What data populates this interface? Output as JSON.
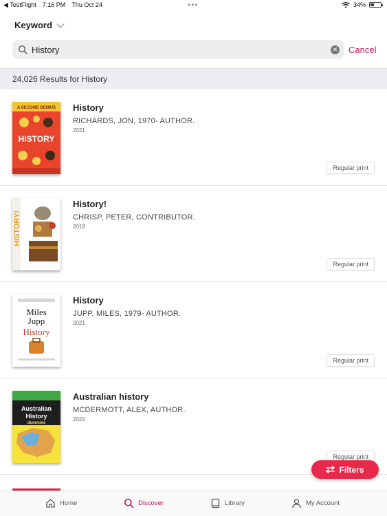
{
  "status_bar": {
    "back_app": "◀ TestFlight",
    "time": "7:16 PM",
    "date": "Thu Oct 24",
    "dots": "•••",
    "battery_percent": "34%",
    "battery_level": 0.34
  },
  "search_type": {
    "label": "Keyword"
  },
  "search": {
    "value": "History",
    "cancel_label": "Cancel"
  },
  "results": {
    "summary": "24,026 Results for History"
  },
  "items": [
    {
      "title": "History",
      "author": "RICHARDS, JON, 1970- AUTHOR.",
      "year": "2021",
      "format": "Regular print"
    },
    {
      "title": "History!",
      "author": "CHRISP, PETER, CONTRIBUTOR.",
      "year": "2019",
      "format": "Regular print"
    },
    {
      "title": "History",
      "author": "JUPP, MILES, 1979- AUTHOR.",
      "year": "2021",
      "format": "Regular print"
    },
    {
      "title": "Australian history",
      "author": "MCDERMOTT, ALEX, AUTHOR.",
      "year": "2022",
      "format": "Regular print"
    }
  ],
  "covers": {
    "c1": {
      "banner": "A SECOND GENIUS",
      "title": "HISTORY"
    },
    "c2": {
      "title": "HISTORY!"
    },
    "c3": {
      "line1": "Miles",
      "line2": "Jupp",
      "line3": "History"
    },
    "c4": {
      "line1": "Australian",
      "line2": "History",
      "line3": "dummies"
    }
  },
  "filters_label": "Filters",
  "tabs": [
    {
      "label": "Home"
    },
    {
      "label": "Discover"
    },
    {
      "label": "Library"
    },
    {
      "label": "My Account"
    }
  ],
  "colors": {
    "accent": "#c2185b",
    "filters_bg": "#e8294a"
  }
}
